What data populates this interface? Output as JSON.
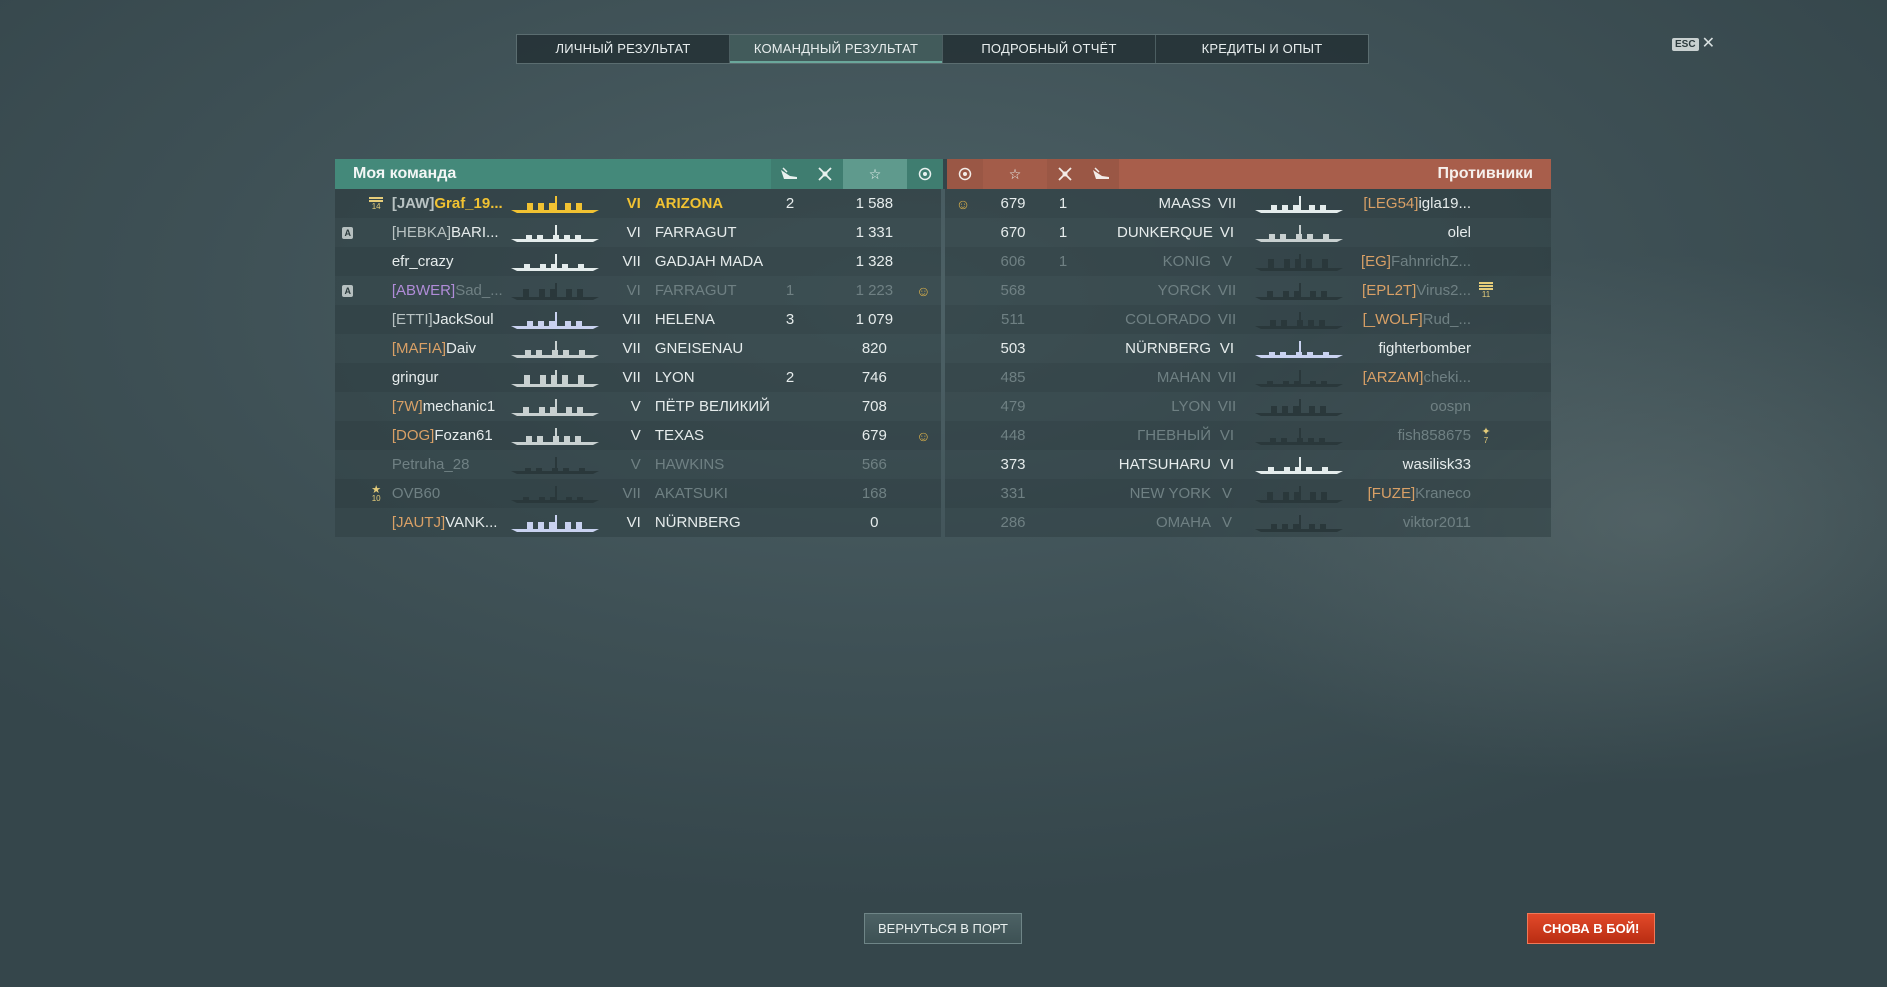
{
  "tabs": [
    {
      "label": "ЛИЧНЫЙ РЕЗУЛЬТАТ",
      "active": false
    },
    {
      "label": "КОМАНДНЫЙ РЕЗУЛЬТАТ",
      "active": true
    },
    {
      "label": "ПОДРОБНЫЙ ОТЧЁТ",
      "active": false
    },
    {
      "label": "КРЕДИТЫ И ОПЫТ",
      "active": false
    }
  ],
  "esc_label": "ESC",
  "close_glyph": "✕",
  "my_team": {
    "title": "Моя команда",
    "color": "#44897a",
    "rows": [
      {
        "rank": "14",
        "emblem": "",
        "clan": "[JAW]",
        "name": "Graf_19...",
        "tier": "VI",
        "ship": "ARIZONA",
        "planes": "2",
        "frags": "",
        "xp": "1 588",
        "base": "",
        "me": true,
        "dead": false,
        "ship_color": "#f1c232"
      },
      {
        "rank": "",
        "emblem": "A",
        "clan": "[HEBKA]",
        "name": "BARI...",
        "tier": "VI",
        "ship": "FARRAGUT",
        "planes": "",
        "frags": "",
        "xp": "1 331",
        "base": "",
        "me": false,
        "dead": false,
        "ship_color": "#e4ecec"
      },
      {
        "rank": "",
        "emblem": "",
        "clan": "",
        "name": "efr_crazy",
        "tier": "VII",
        "ship": "GADJAH MADA",
        "planes": "",
        "frags": "",
        "xp": "1 328",
        "base": "",
        "me": false,
        "dead": false,
        "ship_color": "#e4ecec"
      },
      {
        "rank": "",
        "emblem": "A",
        "clan": "[ABWER]",
        "name": "Sad_...",
        "tier": "VI",
        "ship": "FARRAGUT",
        "planes": "1",
        "frags": "",
        "xp": "1 223",
        "base": "smile",
        "me": false,
        "dead": true,
        "ship_color": "#2a383b"
      },
      {
        "rank": "",
        "emblem": "",
        "clan": "[ETTI]",
        "name": "JackSoul",
        "tier": "VII",
        "ship": "HELENA",
        "planes": "3",
        "frags": "",
        "xp": "1 079",
        "base": "",
        "me": false,
        "dead": false,
        "ship_color": "#c9d2f0"
      },
      {
        "rank": "",
        "emblem": "",
        "clan": "[MAFIA]",
        "name": "Daiv",
        "tier": "VII",
        "ship": "GNEISENAU",
        "planes": "",
        "frags": "",
        "xp": "820",
        "base": "",
        "me": false,
        "dead": false,
        "ship_color": "#c8d0d0"
      },
      {
        "rank": "",
        "emblem": "",
        "clan": "",
        "name": "gringur",
        "tier": "VII",
        "ship": "LYON",
        "planes": "2",
        "frags": "",
        "xp": "746",
        "base": "",
        "me": false,
        "dead": false,
        "ship_color": "#c8d0d0"
      },
      {
        "rank": "",
        "emblem": "",
        "clan": "[7W]",
        "name": "mechanic1",
        "tier": "V",
        "ship": "ПЁТР ВЕЛИКИЙ",
        "planes": "",
        "frags": "",
        "xp": "708",
        "base": "",
        "me": false,
        "dead": false,
        "ship_color": "#c8d0d0"
      },
      {
        "rank": "",
        "emblem": "",
        "clan": "[DOG]",
        "name": "Fozan61",
        "tier": "V",
        "ship": "TEXAS",
        "planes": "",
        "frags": "",
        "xp": "679",
        "base": "smile",
        "me": false,
        "dead": false,
        "ship_color": "#c8d0d0"
      },
      {
        "rank": "",
        "emblem": "",
        "clan": "",
        "name": "Petruha_28",
        "tier": "V",
        "ship": "HAWKINS",
        "planes": "",
        "frags": "",
        "xp": "566",
        "base": "",
        "me": false,
        "dead": true,
        "ship_color": "#2a383b"
      },
      {
        "rank": "10",
        "emblem": "",
        "clan": "",
        "name": "OVB60",
        "tier": "VII",
        "ship": "AKATSUKI",
        "planes": "",
        "frags": "",
        "xp": "168",
        "base": "",
        "me": false,
        "dead": true,
        "ship_color": "#2a383b"
      },
      {
        "rank": "",
        "emblem": "",
        "clan": "[JAUTJ]",
        "name": "VANK...",
        "tier": "VI",
        "ship": "NÜRNBERG",
        "planes": "",
        "frags": "",
        "xp": "0",
        "base": "",
        "me": false,
        "dead": false,
        "ship_color": "#c9d2f0"
      }
    ]
  },
  "enemy_team": {
    "title": "Противники",
    "color": "#a85e4b",
    "rows": [
      {
        "base": "smile",
        "xp": "679",
        "frags": "1",
        "ship": "MAASS",
        "tier": "VII",
        "clan": "[LEG54]",
        "name": "igla19...",
        "rank": "",
        "dead": false,
        "ship_color": "#e4ecec"
      },
      {
        "base": "",
        "xp": "670",
        "frags": "1",
        "ship": "DUNKERQUE",
        "tier": "VI",
        "clan": "",
        "name": "olel",
        "rank": "",
        "dead": false,
        "ship_color": "#c8d0d0"
      },
      {
        "base": "",
        "xp": "606",
        "frags": "1",
        "ship": "KONIG",
        "tier": "V",
        "clan": "[EG]",
        "name": "FahnrichZ...",
        "rank": "",
        "dead": true,
        "ship_color": "#2a383b"
      },
      {
        "base": "",
        "xp": "568",
        "frags": "",
        "ship": "YORCK",
        "tier": "VII",
        "clan": "[EPL2T]",
        "name": "Virus2...",
        "rank": "11",
        "dead": true,
        "ship_color": "#2a383b"
      },
      {
        "base": "",
        "xp": "511",
        "frags": "",
        "ship": "COLORADO",
        "tier": "VII",
        "clan": "[_WOLF]",
        "name": "Rud_...",
        "rank": "",
        "dead": true,
        "ship_color": "#2a383b"
      },
      {
        "base": "",
        "xp": "503",
        "frags": "",
        "ship": "NÜRNBERG",
        "tier": "VI",
        "clan": "",
        "name": "fighterbomber",
        "rank": "",
        "dead": false,
        "ship_color": "#c9d2f0"
      },
      {
        "base": "",
        "xp": "485",
        "frags": "",
        "ship": "MAHAN",
        "tier": "VII",
        "clan": "[ARZAM]",
        "name": "cheki...",
        "rank": "",
        "dead": true,
        "ship_color": "#2a383b"
      },
      {
        "base": "",
        "xp": "479",
        "frags": "",
        "ship": "LYON",
        "tier": "VII",
        "clan": "",
        "name": "oospn",
        "rank": "",
        "dead": true,
        "ship_color": "#2a383b"
      },
      {
        "base": "",
        "xp": "448",
        "frags": "",
        "ship": "ГНЕВНЫЙ",
        "tier": "VI",
        "clan": "",
        "name": "fish858675",
        "rank": "7",
        "dead": true,
        "ship_color": "#2a383b"
      },
      {
        "base": "",
        "xp": "373",
        "frags": "",
        "ship": "HATSUHARU",
        "tier": "VI",
        "clan": "",
        "name": "wasilisk33",
        "rank": "",
        "dead": false,
        "ship_color": "#e4ecec"
      },
      {
        "base": "",
        "xp": "331",
        "frags": "",
        "ship": "NEW YORK",
        "tier": "V",
        "clan": "[FUZE]",
        "name": "Kraneco",
        "rank": "",
        "dead": true,
        "ship_color": "#2a383b"
      },
      {
        "base": "",
        "xp": "286",
        "frags": "",
        "ship": "OMAHA",
        "tier": "V",
        "clan": "",
        "name": "viktor2011",
        "rank": "",
        "dead": true,
        "ship_color": "#2a383b"
      }
    ]
  },
  "buttons": {
    "port": "ВЕРНУТЬСЯ В ПОРТ",
    "battle": "СНОВА В БОЙ!"
  },
  "colors": {
    "my_team_header": "#44897a",
    "enemy_header": "#a85e4b",
    "player_highlight": "#f1c232",
    "clan_tag": "#d9a066",
    "battle_button": "#d63c1e"
  }
}
